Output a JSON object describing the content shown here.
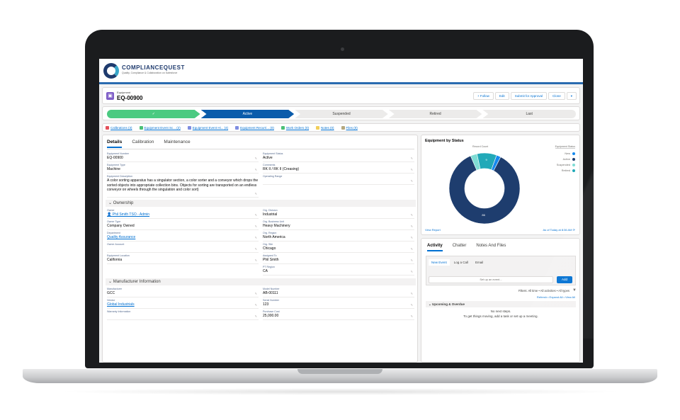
{
  "brand": {
    "name": "COMPLIANCEQUEST",
    "tagline": "Quality, Compliance & Collaboration on Salesforce"
  },
  "record": {
    "type_label": "Equipment",
    "name": "EQ-00900",
    "buttons": [
      "+ Follow",
      "Edit",
      "Submit for Approval",
      "Clone",
      "▾"
    ]
  },
  "path": {
    "steps": [
      {
        "label": "✓",
        "state": "done"
      },
      {
        "label": "Active",
        "state": "current"
      },
      {
        "label": "Suspended",
        "state": "todo"
      },
      {
        "label": "Retired",
        "state": "todo"
      },
      {
        "label": "Last",
        "state": "todo"
      }
    ]
  },
  "related": [
    {
      "label": "Calibrations (3)",
      "color": "#e4505a"
    },
    {
      "label": "Equipment Event Sc... (2)",
      "color": "#4bc076"
    },
    {
      "label": "Equipment Event Hi... (4)",
      "color": "#7f8de1"
    },
    {
      "label": "Equipment Recurri... (0)",
      "color": "#7f8de1"
    },
    {
      "label": "Work Orders (0)",
      "color": "#4bc076"
    },
    {
      "label": "Notes (0)",
      "color": "#f2cf5b"
    },
    {
      "label": "Files (0)",
      "color": "#b5a87f"
    }
  ],
  "details": {
    "tabs": [
      "Details",
      "Calibration",
      "Maintenance"
    ],
    "fields_top_left": [
      {
        "label": "Equipment Number",
        "value": "EQ-00900"
      },
      {
        "label": "Equipment Type",
        "value": "Machine"
      },
      {
        "label": "Equipment Description",
        "value": "A color sorting apparatus has a singulator section, a color sorter and a conveyor which drops the sorted objects into appropriate collection bins. Objects for sorting are transported on an endless conveyor on wheels through the singulation and color sort)"
      }
    ],
    "fields_top_right": [
      {
        "label": "Equipment Status",
        "value": "Active"
      },
      {
        "label": "Comments",
        "value": "RK II / RK II (Creasing)"
      },
      {
        "label": "Operating Range",
        "value": ""
      }
    ],
    "ownership_title": "Ownership",
    "ownership_left": [
      {
        "label": "Owner",
        "value": "Phil Smith TSO - Admin",
        "link": true
      },
      {
        "label": "Owner Type",
        "value": "Company Owned"
      },
      {
        "label": "Department",
        "value": "Quality Assurance",
        "link": true
      },
      {
        "label": "Owner Account",
        "value": ""
      },
      {
        "label": "Equipment Location",
        "value": "California"
      }
    ],
    "ownership_right": [
      {
        "label": "Org. Division",
        "value": "Industrial"
      },
      {
        "label": "Org. Business Unit",
        "value": "Heavy Machinery"
      },
      {
        "label": "Org. Region",
        "value": "North America"
      },
      {
        "label": "Org. Site",
        "value": "Chicago"
      },
      {
        "label": "Assigned To",
        "value": "Phil Smith"
      },
      {
        "label": "PT Region",
        "value": "CA"
      }
    ],
    "manufacturer_title": "Manufacturer Information",
    "manufacturer_left": [
      {
        "label": "Manufacturer",
        "value": "GCC"
      },
      {
        "label": "Vendor",
        "value": "Global Industrials",
        "link": true
      },
      {
        "label": "Warranty Information",
        "value": ""
      }
    ],
    "manufacturer_right": [
      {
        "label": "Model Number",
        "value": "AB-00111"
      },
      {
        "label": "Serial Number",
        "value": "123"
      },
      {
        "label": "Purchase Cost",
        "value": "25,000.00"
      }
    ]
  },
  "chart_card": {
    "title": "Equipment by Status",
    "record_count_label": "Record Count",
    "legend_title": "Equipment Status",
    "footer_left": "View Report",
    "footer_right": "As of Today at 8:36 AM"
  },
  "chart_data": {
    "type": "pie",
    "categories": [
      "New",
      "Active",
      "Suspended",
      "Retired"
    ],
    "values": [
      2,
      86,
      3,
      9
    ],
    "colors": [
      "#1589ee",
      "#1e3d6e",
      "#7fdcd4",
      "#22a9b8"
    ],
    "slice_labels": [
      "",
      "86",
      "",
      "9"
    ],
    "legend_position": "top-right"
  },
  "activity": {
    "tabs": [
      "Activity",
      "Chatter",
      "Notes And Files"
    ],
    "subtabs": [
      "New Event",
      "Log a Call",
      "Email"
    ],
    "event_placeholder": "Set up an event...",
    "add_label": "Add",
    "filters": "Filters: All time • All activities • All types",
    "refresh": "Refresh • Expand All • View All",
    "upcoming": "Upcoming & Overdue",
    "no_steps": "No next steps.",
    "no_steps_hint": "To get things moving, add a task or set up a meeting."
  }
}
